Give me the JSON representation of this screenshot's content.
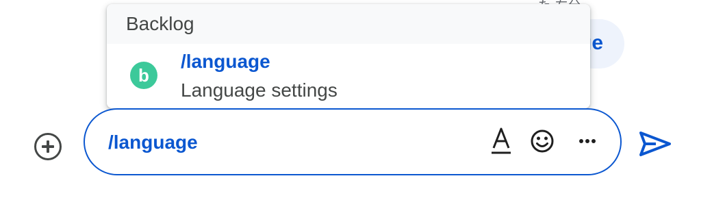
{
  "background": {
    "top_fragment": "た 右分",
    "chip_text": "ge"
  },
  "popup": {
    "header": "Backlog",
    "items": [
      {
        "command": "/language",
        "description": "Language settings",
        "icon": "backlog-app-icon",
        "avatar_letter": "b",
        "avatar_color": "#3cc99a"
      }
    ]
  },
  "composer": {
    "value": "/language",
    "accent_color": "#0b57d0",
    "icons": [
      "format-text-icon",
      "emoji-icon",
      "more-options-icon"
    ]
  },
  "actions": {
    "add": "add-circle-icon",
    "send": "send-icon"
  }
}
